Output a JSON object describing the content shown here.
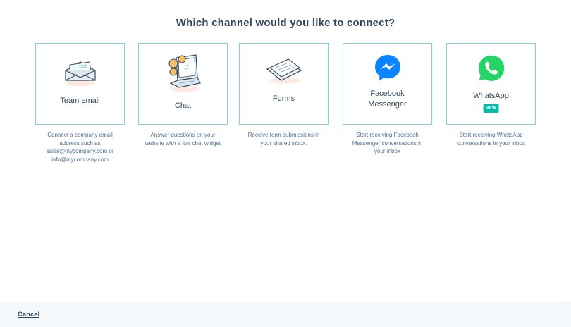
{
  "title": "Which channel would you like to connect?",
  "channels": [
    {
      "label": "Team email",
      "description": "Connect a company email address such as sales@mycompany.com or info@mycompany.com",
      "icon": "envelope-icon"
    },
    {
      "label": "Chat",
      "description": "Answer questions on your website with a live chat widget",
      "icon": "laptop-chat-icon"
    },
    {
      "label": "Forms",
      "description": "Receive form submissions in your shared inbox.",
      "icon": "forms-icon"
    },
    {
      "label_line1": "Facebook",
      "label_line2": "Messenger",
      "description": "Start receiving Facebook Messenger conversations in your inbox",
      "icon": "messenger-icon"
    },
    {
      "label": "WhatsApp",
      "badge": "NEW",
      "description": "Start receiving WhatsApp conversations in your inbox",
      "icon": "whatsapp-icon"
    }
  ],
  "footer": {
    "cancel_label": "Cancel"
  },
  "colors": {
    "card_border": "#7fd1de",
    "badge": "#00bda5",
    "messenger": "#0a84ff",
    "whatsapp": "#25d366",
    "text": "#33475b"
  }
}
